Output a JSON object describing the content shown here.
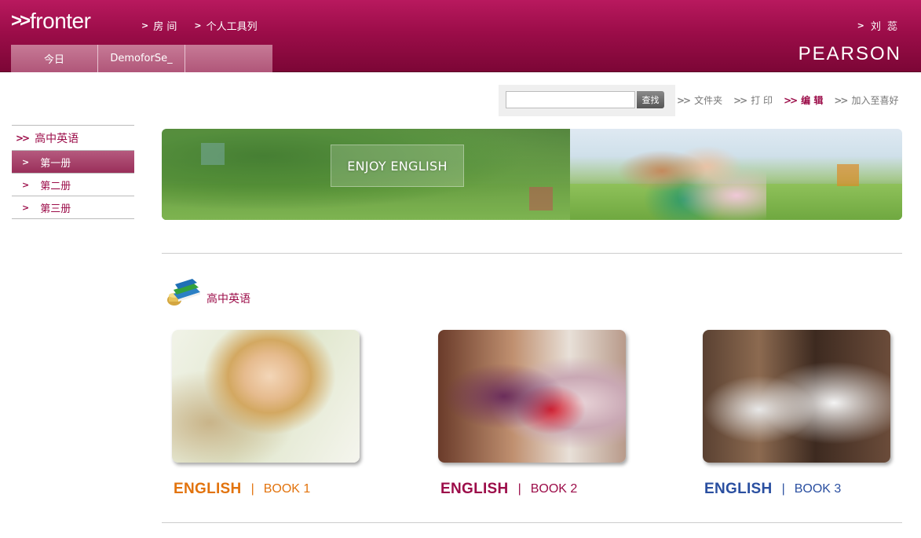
{
  "header": {
    "logo": "fronter",
    "nav": [
      "房 间",
      "个人工具列"
    ],
    "user": "刘 蕊",
    "brand": "PEARSON",
    "tabs": [
      "今日",
      "DemoforSe_",
      ""
    ]
  },
  "toolbar": {
    "search_placeholder": "",
    "search_button": "查找",
    "tools": [
      "文件夹",
      "打 印",
      "编 辑",
      "加入至喜好"
    ],
    "active_tool": "编 辑"
  },
  "sidebar": {
    "heading": "高中英语",
    "items": [
      "第一册",
      "第二册",
      "第三册"
    ],
    "active_item": "第一册"
  },
  "banner": {
    "caption": "ENJOY ENGLISH"
  },
  "section": {
    "title": "高中英语"
  },
  "cards": [
    {
      "english": "ENGLISH",
      "sep": "|",
      "book": "BOOK 1",
      "color": "#e2730d"
    },
    {
      "english": "ENGLISH",
      "sep": "|",
      "book": "BOOK 2",
      "color": "#9c0d49"
    },
    {
      "english": "ENGLISH",
      "sep": "|",
      "book": "BOOK 3",
      "color": "#2a4fa0"
    }
  ],
  "colors": {
    "brand": "#9c0d49",
    "header_top": "#b8195e",
    "header_bottom": "#7c0636"
  }
}
